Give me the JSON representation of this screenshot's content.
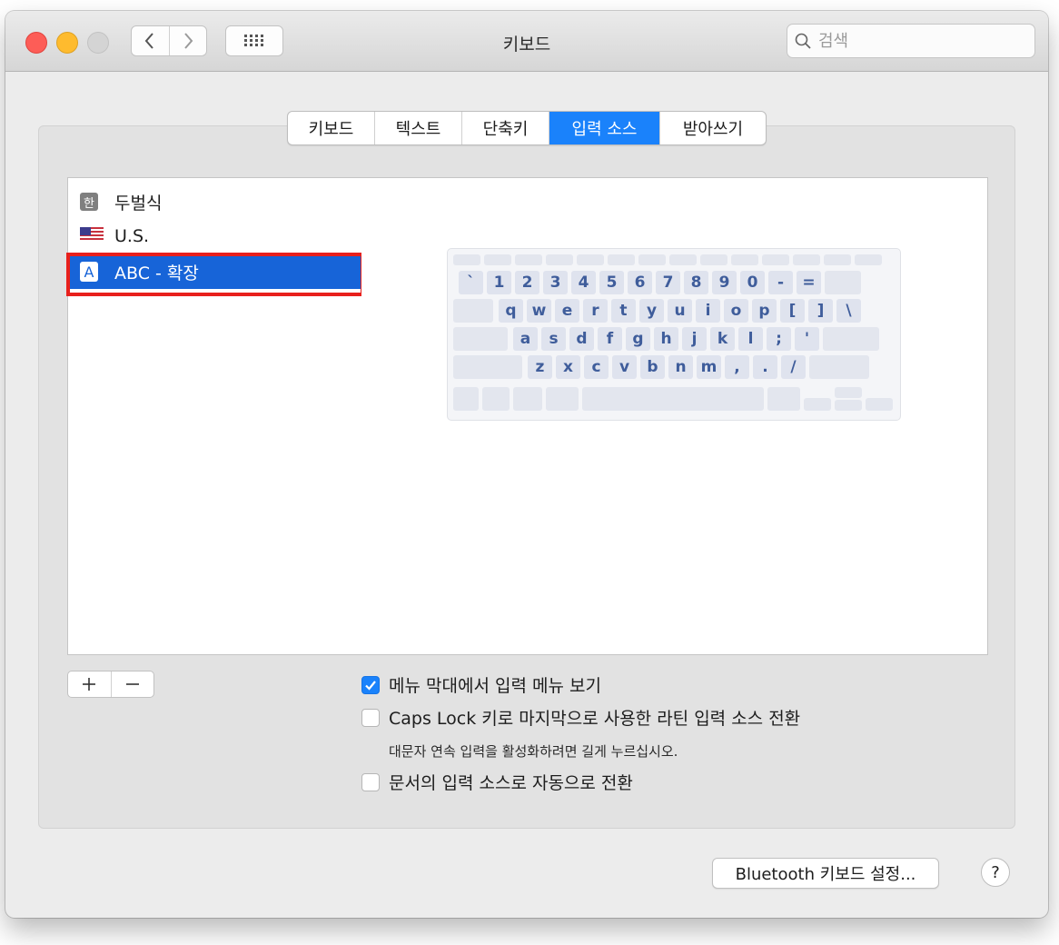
{
  "window": {
    "title": "키보드"
  },
  "search": {
    "placeholder": "검색"
  },
  "tabs": [
    {
      "label": "키보드",
      "active": false
    },
    {
      "label": "텍스트",
      "active": false
    },
    {
      "label": "단축키",
      "active": false
    },
    {
      "label": "입력 소스",
      "active": true
    },
    {
      "label": "받아쓰기",
      "active": false
    }
  ],
  "input_sources": [
    {
      "label": "두벌식",
      "icon": "hangul-icon",
      "icon_text": "한",
      "selected": false
    },
    {
      "label": "U.S.",
      "icon": "us-flag-icon",
      "selected": false
    },
    {
      "label": "ABC - 확장",
      "icon": "abc-icon",
      "icon_text": "A",
      "selected": true
    }
  ],
  "keyboard": {
    "row1": [
      "`",
      "1",
      "2",
      "3",
      "4",
      "5",
      "6",
      "7",
      "8",
      "9",
      "0",
      "-",
      "="
    ],
    "row2": [
      "q",
      "w",
      "e",
      "r",
      "t",
      "y",
      "u",
      "i",
      "o",
      "p",
      "[",
      "]",
      "\\"
    ],
    "row3": [
      "a",
      "s",
      "d",
      "f",
      "g",
      "h",
      "j",
      "k",
      "l",
      ";",
      "'"
    ],
    "row4": [
      "z",
      "x",
      "c",
      "v",
      "b",
      "n",
      "m",
      ",",
      ".",
      "/"
    ]
  },
  "options": {
    "show_input_menu": {
      "label": "메뉴 막대에서 입력 메뉴 보기",
      "checked": true
    },
    "caps_lock_switch": {
      "label": "Caps Lock 키로 마지막으로 사용한 라틴 입력 소스 전환",
      "checked": false,
      "note": "대문자 연속 입력을 활성화하려면 길게 누르십시오."
    },
    "auto_switch": {
      "label": "문서의 입력 소스로 자동으로 전환",
      "checked": false
    }
  },
  "buttons": {
    "bluetooth": "Bluetooth 키보드 설정...",
    "help": "?"
  },
  "colors": {
    "accent": "#1a82fb",
    "selection": "#1764d8",
    "highlight_border": "#e8201c"
  }
}
